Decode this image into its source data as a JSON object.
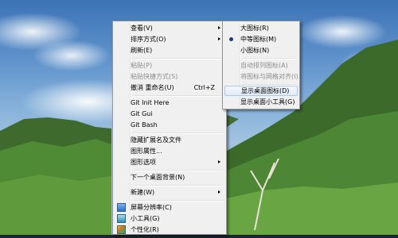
{
  "main_menu": {
    "items": [
      {
        "label": "查看(V)"
      },
      {
        "label": "排序方式(O)"
      },
      {
        "label": "刷新(E)"
      },
      {
        "label": "粘贴(P)"
      },
      {
        "label": "粘贴快捷方式(S)"
      },
      {
        "label": "撤消 重命名(U)",
        "shortcut": "Ctrl+Z"
      },
      {
        "label": "Git Init Here"
      },
      {
        "label": "Git Gui"
      },
      {
        "label": "Git Bash"
      },
      {
        "label": "隐藏扩展名及文件"
      },
      {
        "label": "图形属性..."
      },
      {
        "label": "图形选项"
      },
      {
        "label": "下一个桌面背景(N)"
      },
      {
        "label": "新建(W)"
      },
      {
        "label": "屏幕分辨率(C)",
        "icon": "screen-resolution-icon"
      },
      {
        "label": "小工具(G)",
        "icon": "gadgets-icon"
      },
      {
        "label": "个性化(R)",
        "icon": "personalize-icon"
      }
    ]
  },
  "view_submenu": {
    "items": [
      {
        "label": "大图标(R)"
      },
      {
        "label": "中等图标(M)",
        "selected": true
      },
      {
        "label": "小图标(N)"
      },
      {
        "label": "自动排列图标(A)"
      },
      {
        "label": "将图标与网格对齐(I)"
      },
      {
        "label": "显示桌面图标(D)",
        "highlighted": true
      },
      {
        "label": "显示桌面小工具(G)"
      }
    ]
  },
  "colors": {
    "menu_bg": "#f0f0f0",
    "highlight_border": "#a8c8ec",
    "disabled_text": "#8d8d8d"
  }
}
